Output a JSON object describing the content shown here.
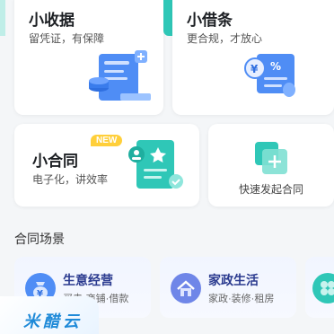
{
  "cards": {
    "receipt": {
      "title": "小收据",
      "subtitle": "留凭证，有保障"
    },
    "iou": {
      "title": "小借条",
      "subtitle": "更合规，才放心"
    },
    "contract": {
      "title": "小合同",
      "subtitle": "电子化，讲效率",
      "badge": "NEW"
    },
    "quick": {
      "label": "快速发起合同"
    }
  },
  "section": {
    "title": "合同场景"
  },
  "scenes": [
    {
      "title": "生意经营",
      "subtitle": "买卖·商铺·借款",
      "icon": "money-bag-icon"
    },
    {
      "title": "家政生活",
      "subtitle": "家政·装修·租房",
      "icon": "house-icon"
    },
    {
      "icon": "more-scene-icon"
    }
  ],
  "watermark": {
    "text": "米醋云"
  },
  "colors": {
    "accent": "#2fc7b7",
    "badge": "#ffcf3a",
    "scene_title": "#2a3a8f",
    "icon_blue": "#4f8df5"
  }
}
